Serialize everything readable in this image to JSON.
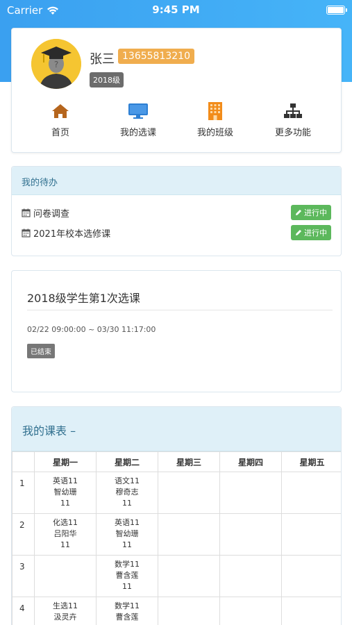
{
  "status": {
    "carrier": "Carrier",
    "time": "9:45 PM"
  },
  "profile": {
    "name": "张三",
    "phone": "13655813210",
    "grade": "2018级",
    "nav": [
      {
        "label": "首页",
        "icon": "home-icon"
      },
      {
        "label": "我的选课",
        "icon": "monitor-icon"
      },
      {
        "label": "我的班级",
        "icon": "building-icon"
      },
      {
        "label": "更多功能",
        "icon": "sitemap-icon"
      }
    ]
  },
  "todo": {
    "title": "我的待办",
    "items": [
      {
        "label": "问卷调查",
        "status": "进行中"
      },
      {
        "label": "2021年校本选修课",
        "status": "进行中"
      }
    ]
  },
  "selection": {
    "title": "2018级学生第1次选课",
    "time": "02/22 09:00:00 ~ 03/30 11:17:00",
    "status": "已结束"
  },
  "schedule": {
    "title": "我的课表 –",
    "days": [
      "星期一",
      "星期二",
      "星期三",
      "星期四",
      "星期五"
    ],
    "rows": [
      {
        "num": "1",
        "cells": [
          [
            "英语11",
            "智幼珊",
            "11"
          ],
          [
            "语文11",
            "穆奇志",
            "11"
          ],
          [],
          [],
          []
        ]
      },
      {
        "num": "2",
        "cells": [
          [
            "化选11",
            "吕阳华",
            "11"
          ],
          [
            "英语11",
            "智幼珊",
            "11"
          ],
          [],
          [],
          []
        ]
      },
      {
        "num": "3",
        "cells": [
          [],
          [
            "数学11",
            "曹含莲",
            "11"
          ],
          [],
          [],
          []
        ]
      },
      {
        "num": "4",
        "cells": [
          [
            "生选11",
            "汲灵卉",
            ""
          ],
          [
            "数学11",
            "曹含莲",
            ""
          ],
          [],
          [],
          []
        ]
      }
    ]
  },
  "colors": {
    "header_blue": "#3aa0f0",
    "panel_blue": "#dff0f8",
    "green": "#5cb85c",
    "orange": "#f0ad4e"
  }
}
